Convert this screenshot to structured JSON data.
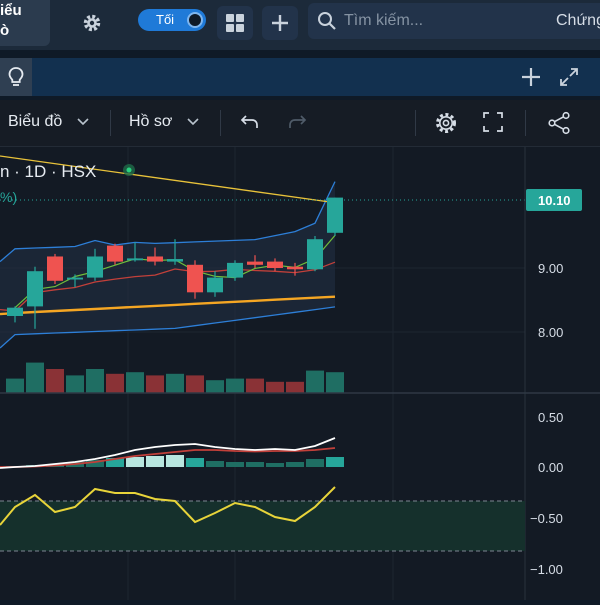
{
  "topbar": {
    "tab_label_line1": "iểu",
    "tab_label_line2": "ò",
    "theme_toggle_label": "Tối",
    "search_placeholder": "Tìm kiếm...",
    "right_text": "Chứng"
  },
  "toolbar": {
    "chart_menu_label": "Biểu đồ",
    "profile_menu_label": "Hồ sơ"
  },
  "chart": {
    "symbol_info": "n · 1D · HSX",
    "percent_fragment": "%)",
    "last_price_label": "10.10",
    "price_ticks": [
      "9.00",
      "8.00"
    ],
    "indicator_ticks": [
      "0.50",
      "0.00",
      "−0.50",
      "−1.00"
    ]
  },
  "colors": {
    "up": "#26a69a",
    "down": "#ef5350",
    "accent": "#1f7ad8",
    "ma_yellow": "#e8c23a",
    "ma_orange": "#f5a623",
    "band_blue": "#2d7fd8"
  },
  "chart_data": {
    "type": "candlestick",
    "interval": "1D",
    "exchange": "HSX",
    "last_price": 10.1,
    "price_axis": {
      "ticks": [
        9.0,
        8.0
      ]
    },
    "candles": [
      {
        "o": 8.25,
        "h": 8.4,
        "l": 8.15,
        "c": 8.38
      },
      {
        "o": 8.4,
        "h": 9.02,
        "l": 8.05,
        "c": 8.95
      },
      {
        "o": 9.18,
        "h": 9.22,
        "l": 8.75,
        "c": 8.8
      },
      {
        "o": 8.82,
        "h": 8.9,
        "l": 8.7,
        "c": 8.85
      },
      {
        "o": 8.85,
        "h": 9.3,
        "l": 8.8,
        "c": 9.18
      },
      {
        "o": 9.35,
        "h": 9.38,
        "l": 9.05,
        "c": 9.1
      },
      {
        "o": 9.12,
        "h": 9.4,
        "l": 9.1,
        "c": 9.15
      },
      {
        "o": 9.18,
        "h": 9.32,
        "l": 9.04,
        "c": 9.1
      },
      {
        "o": 9.1,
        "h": 9.45,
        "l": 9.05,
        "c": 9.14
      },
      {
        "o": 9.05,
        "h": 9.12,
        "l": 8.52,
        "c": 8.62
      },
      {
        "o": 8.62,
        "h": 8.95,
        "l": 8.55,
        "c": 8.85
      },
      {
        "o": 8.85,
        "h": 9.12,
        "l": 8.8,
        "c": 9.08
      },
      {
        "o": 9.1,
        "h": 9.2,
        "l": 9.0,
        "c": 9.05
      },
      {
        "o": 9.1,
        "h": 9.15,
        "l": 8.95,
        "c": 9.0
      },
      {
        "o": 9.02,
        "h": 9.08,
        "l": 8.88,
        "c": 8.98
      },
      {
        "o": 8.98,
        "h": 9.5,
        "l": 8.95,
        "c": 9.45
      },
      {
        "o": 9.55,
        "h": 10.1,
        "l": 9.5,
        "c": 10.1
      }
    ],
    "volume": [
      0.45,
      0.95,
      0.75,
      0.55,
      0.75,
      0.6,
      0.65,
      0.55,
      0.6,
      0.55,
      0.4,
      0.45,
      0.45,
      0.35,
      0.35,
      0.7,
      0.65
    ],
    "macd": {
      "macd": [
        0.0,
        0.01,
        0.03,
        0.05,
        0.08,
        0.12,
        0.17,
        0.2,
        0.22,
        0.23,
        0.2,
        0.18,
        0.17,
        0.18,
        0.17,
        0.21,
        0.29
      ],
      "signal": [
        0.0,
        0.005,
        0.015,
        0.03,
        0.05,
        0.08,
        0.11,
        0.13,
        0.15,
        0.17,
        0.17,
        0.16,
        0.155,
        0.16,
        0.16,
        0.17,
        0.19
      ],
      "histogram": [
        0.01,
        0.02,
        0.03,
        0.05,
        0.07,
        0.09,
        0.1,
        0.11,
        0.12,
        0.09,
        0.06,
        0.05,
        0.05,
        0.04,
        0.05,
        0.08,
        0.1
      ]
    },
    "oscillator": [
      -0.4,
      -0.28,
      -0.45,
      -0.4,
      -0.22,
      -0.26,
      -0.26,
      -0.32,
      -0.34,
      -0.55,
      -0.46,
      -0.36,
      -0.4,
      -0.5,
      -0.54,
      -0.4,
      -0.2
    ],
    "indicator_axis": {
      "ticks": [
        0.5,
        0.0,
        -0.5,
        -1.0
      ]
    }
  }
}
